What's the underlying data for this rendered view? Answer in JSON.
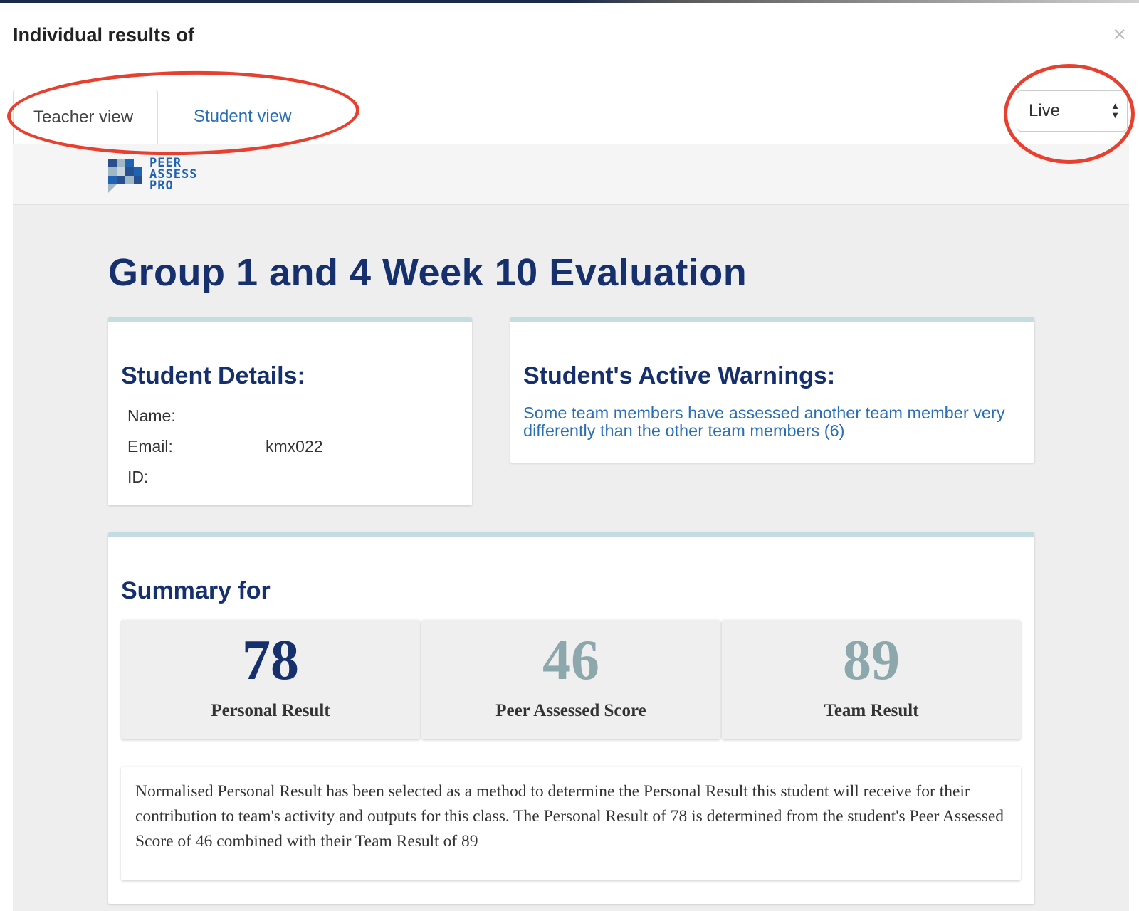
{
  "modal": {
    "title": "Individual results of",
    "close_symbol": "×"
  },
  "tabs": [
    {
      "label": "Teacher view",
      "active": true
    },
    {
      "label": "Student view",
      "active": false
    }
  ],
  "mode_select": {
    "selected": "Live"
  },
  "logo": {
    "line1": "PEER",
    "line2": "ASSESS",
    "line3": "PRO"
  },
  "page": {
    "title": "Group 1 and 4 Week 10 Evaluation"
  },
  "student_details": {
    "heading": "Student Details:",
    "fields": [
      {
        "label": "Name:",
        "value": ""
      },
      {
        "label": "Email:",
        "value": "kmx022"
      },
      {
        "label": "ID:",
        "value": ""
      }
    ]
  },
  "warnings": {
    "heading": "Student's Active Warnings:",
    "items": [
      "Some team members have assessed another team member very differently than the other team members (6)"
    ]
  },
  "summary": {
    "heading": "Summary for",
    "scores": [
      {
        "value": "78",
        "label": "Personal Result"
      },
      {
        "value": "46",
        "label": "Peer Assessed Score"
      },
      {
        "value": "89",
        "label": "Team Result"
      }
    ],
    "explanation": "Normalised Personal Result has been selected as a method to determine the Personal Result this student will receive for their contribution to team's activity and outputs for this class. The Personal Result of 78 is determined from the student's Peer Assessed Score of 46 combined with their Team Result of 89"
  },
  "colors": {
    "brand_navy": "#16306e",
    "link_blue": "#2a6fb5",
    "score_muted": "#8ca8ad",
    "annotation_red": "#e8402f",
    "card_accent": "#c4dde2"
  }
}
